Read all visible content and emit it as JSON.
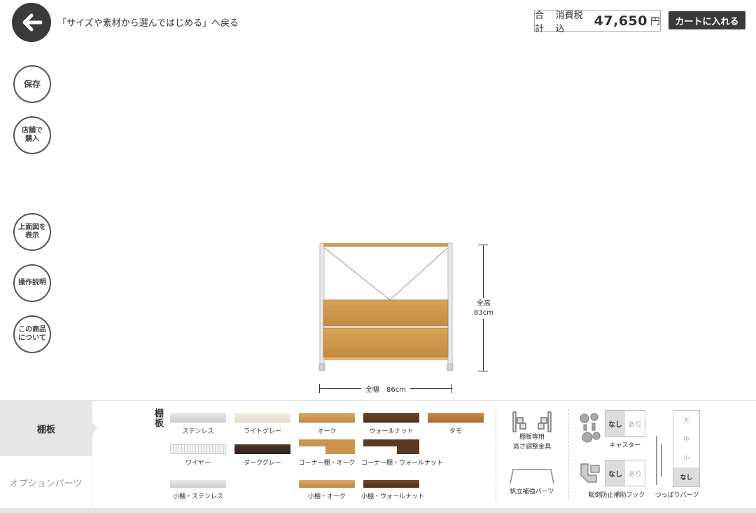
{
  "header": {
    "back_label": "「サイズや素材から選んではじめる」へ戻る",
    "total_label": "合計",
    "tax_label": "消費税込",
    "price": "47,650",
    "currency": "円",
    "cart_button": "カートに入れる"
  },
  "side_buttons": {
    "save": "保存",
    "store_purchase": "店舗で\n購入",
    "top_view": "上面図を\n表示",
    "instructions": "操作説明",
    "about_product": "この商品\nについて"
  },
  "dimensions": {
    "width_label": "全幅　86cm",
    "height_label_1": "全高",
    "height_label_2": "83cm"
  },
  "tabs": {
    "shelf": "棚板",
    "options": "オプションパーツ"
  },
  "shelf_panel": {
    "title": "棚板",
    "materials": [
      {
        "label": "ステンレス",
        "color": "#d6d8da"
      },
      {
        "label": "ライトグレー",
        "color": "#ece6da"
      },
      {
        "label": "オーク",
        "color": "#c9954e"
      },
      {
        "label": "ウォールナット",
        "color": "#5a3a22"
      },
      {
        "label": "タモ",
        "color": "#b57b3d"
      },
      {
        "label": "ワイヤー",
        "color": "#e6e7e8"
      },
      {
        "label": "ダークグレー",
        "color": "#3a2c24"
      },
      {
        "label": "コーナー棚・オーク",
        "color": "#c9954e"
      },
      {
        "label": "コーナー棚・ウォールナット",
        "color": "#5a3a22"
      },
      {
        "label": "小棚・ステンレス",
        "color": "#d6d8da"
      },
      {
        "label": "小棚・オーク",
        "color": "#c9954e"
      },
      {
        "label": "小棚・ウォールナット",
        "color": "#5a3a22"
      }
    ]
  },
  "parts": {
    "height_adjust": "棚板専用\n高さ調整金具",
    "sail_reinforce": "帆立補強パーツ",
    "caster_label": "キャスター",
    "antitip_label": "転倒防止補助フック",
    "tension_label": "つっぱりパーツ",
    "none": "なし",
    "yes": "あり",
    "sizes": [
      "大",
      "中",
      "小",
      "なし"
    ]
  }
}
